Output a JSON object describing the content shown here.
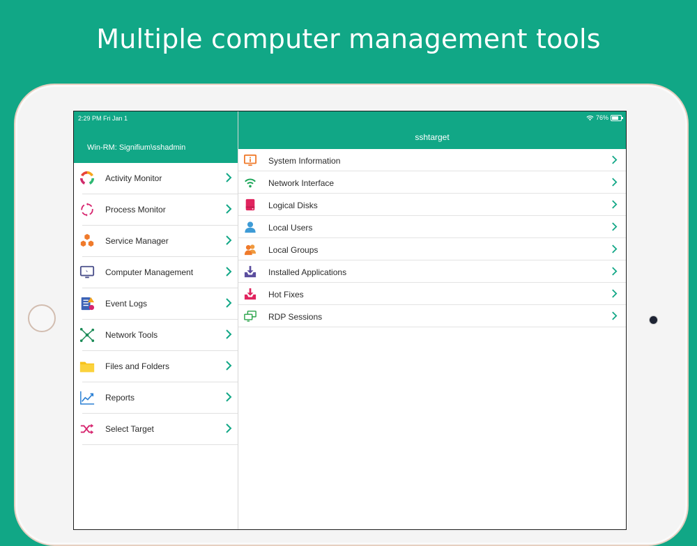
{
  "headline": "Multiple computer management tools",
  "status": {
    "time": "2:29 PM   Fri Jan 1",
    "battery": "76%"
  },
  "connection": "Win-RM: Signifium\\sshadmin",
  "target": "sshtarget",
  "colors": {
    "accent": "#11a786",
    "chevron": "#11a786"
  },
  "sidebar": {
    "items": [
      {
        "label": "Activity Monitor",
        "icon": "activity-ring-icon"
      },
      {
        "label": "Process Monitor",
        "icon": "process-cycle-icon"
      },
      {
        "label": "Service Manager",
        "icon": "hexagons-icon"
      },
      {
        "label": "Computer Management",
        "icon": "monitor-icon"
      },
      {
        "label": "Event Logs",
        "icon": "event-log-icon"
      },
      {
        "label": "Network Tools",
        "icon": "network-nodes-icon"
      },
      {
        "label": "Files and Folders",
        "icon": "folder-icon"
      },
      {
        "label": "Reports",
        "icon": "line-chart-icon"
      },
      {
        "label": "Select Target",
        "icon": "shuffle-icon"
      }
    ]
  },
  "details": {
    "items": [
      {
        "label": "System Information",
        "icon": "info-monitor-icon"
      },
      {
        "label": "Network Interface",
        "icon": "wifi-icon"
      },
      {
        "label": "Logical Disks",
        "icon": "disk-icon"
      },
      {
        "label": "Local Users",
        "icon": "user-icon"
      },
      {
        "label": "Local Groups",
        "icon": "users-icon"
      },
      {
        "label": "Installed Applications",
        "icon": "install-tray-icon"
      },
      {
        "label": "Hot Fixes",
        "icon": "hotfix-tray-icon"
      },
      {
        "label": "RDP Sessions",
        "icon": "remote-desktop-icon"
      }
    ]
  }
}
